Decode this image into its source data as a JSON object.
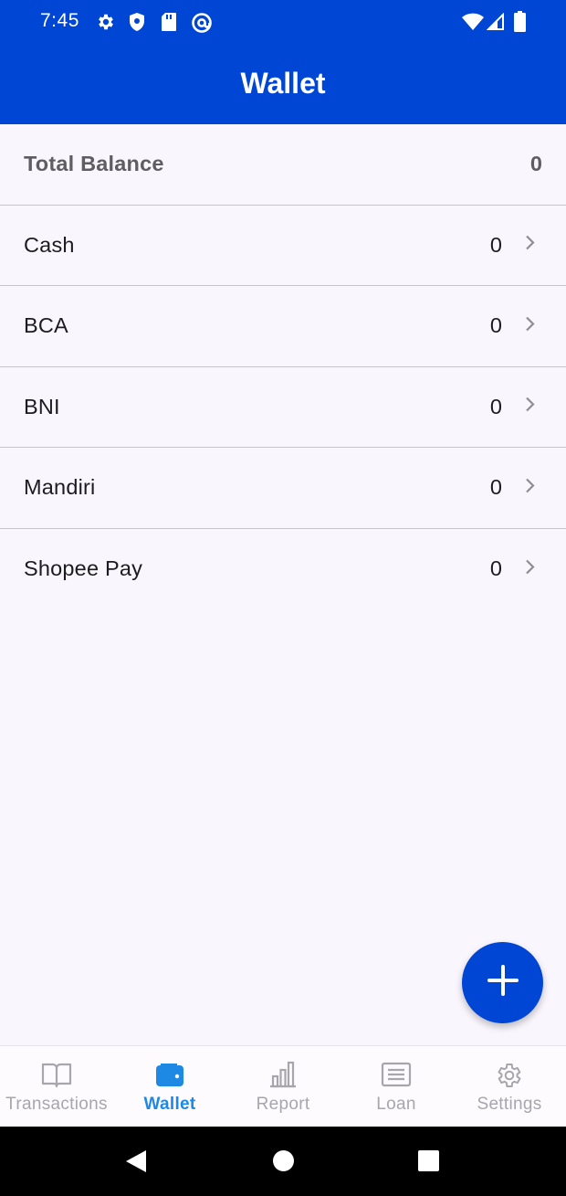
{
  "status_bar": {
    "time": "7:45",
    "icons_left": [
      "gear-icon",
      "shield-icon",
      "sd-card-icon",
      "at-sign-icon"
    ],
    "icons_right": [
      "wifi-icon",
      "signal-icon",
      "battery-icon"
    ]
  },
  "app_bar": {
    "title": "Wallet"
  },
  "total": {
    "label": "Total Balance",
    "value": "0"
  },
  "wallets": [
    {
      "name": "Cash",
      "balance": "0"
    },
    {
      "name": "BCA",
      "balance": "0"
    },
    {
      "name": "BNI",
      "balance": "0"
    },
    {
      "name": "Mandiri",
      "balance": "0"
    },
    {
      "name": "Shopee Pay",
      "balance": "0"
    }
  ],
  "fab": {
    "icon": "plus-icon"
  },
  "bottom_nav": {
    "items": [
      {
        "label": "Transactions",
        "icon": "book-icon",
        "active": false
      },
      {
        "label": "Wallet",
        "icon": "wallet-icon",
        "active": true
      },
      {
        "label": "Report",
        "icon": "bar-chart-icon",
        "active": false
      },
      {
        "label": "Loan",
        "icon": "document-icon",
        "active": false
      },
      {
        "label": "Settings",
        "icon": "gear-icon",
        "active": false
      }
    ]
  },
  "colors": {
    "primary": "#0046d5",
    "active_nav": "#1e88e5",
    "inactive_nav": "#a8a6ab",
    "background": "#f9f7fd"
  }
}
